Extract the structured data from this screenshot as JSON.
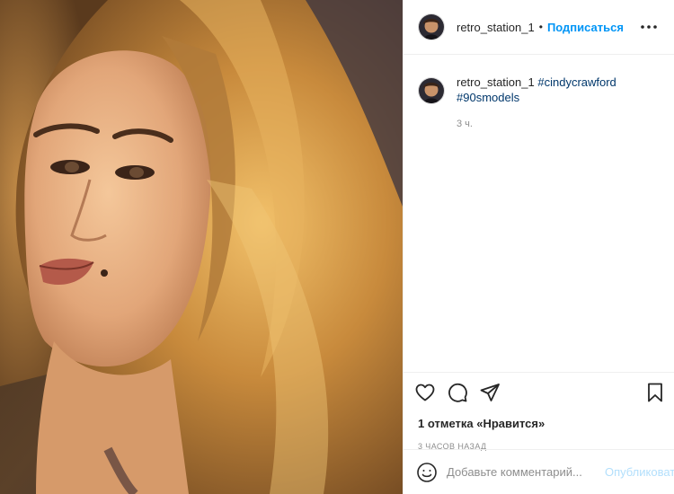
{
  "post": {
    "username": "retro_station_1",
    "dot": "•",
    "follow_label": "Подписаться",
    "caption": {
      "username": "retro_station_1",
      "tags": [
        "#cindycrawford",
        "#90smodels"
      ],
      "time": "3 ч."
    },
    "likes_text": "1 отметка «Нравится»",
    "posted_ago": "3 часов назад",
    "comment": {
      "placeholder": "Добавьте комментарий...",
      "publish_label": "Опубликовать"
    }
  },
  "icons": {
    "more": "more-horizontal-icon",
    "like": "heart-icon",
    "comment": "comment-bubble-icon",
    "share": "paper-plane-icon",
    "save": "bookmark-icon",
    "emoji": "smiley-face-icon"
  },
  "colors": {
    "accent": "#0095f6",
    "hashtag": "#00376b",
    "muted": "#8e8e8e",
    "publish_disabled": "#b2dffc"
  }
}
